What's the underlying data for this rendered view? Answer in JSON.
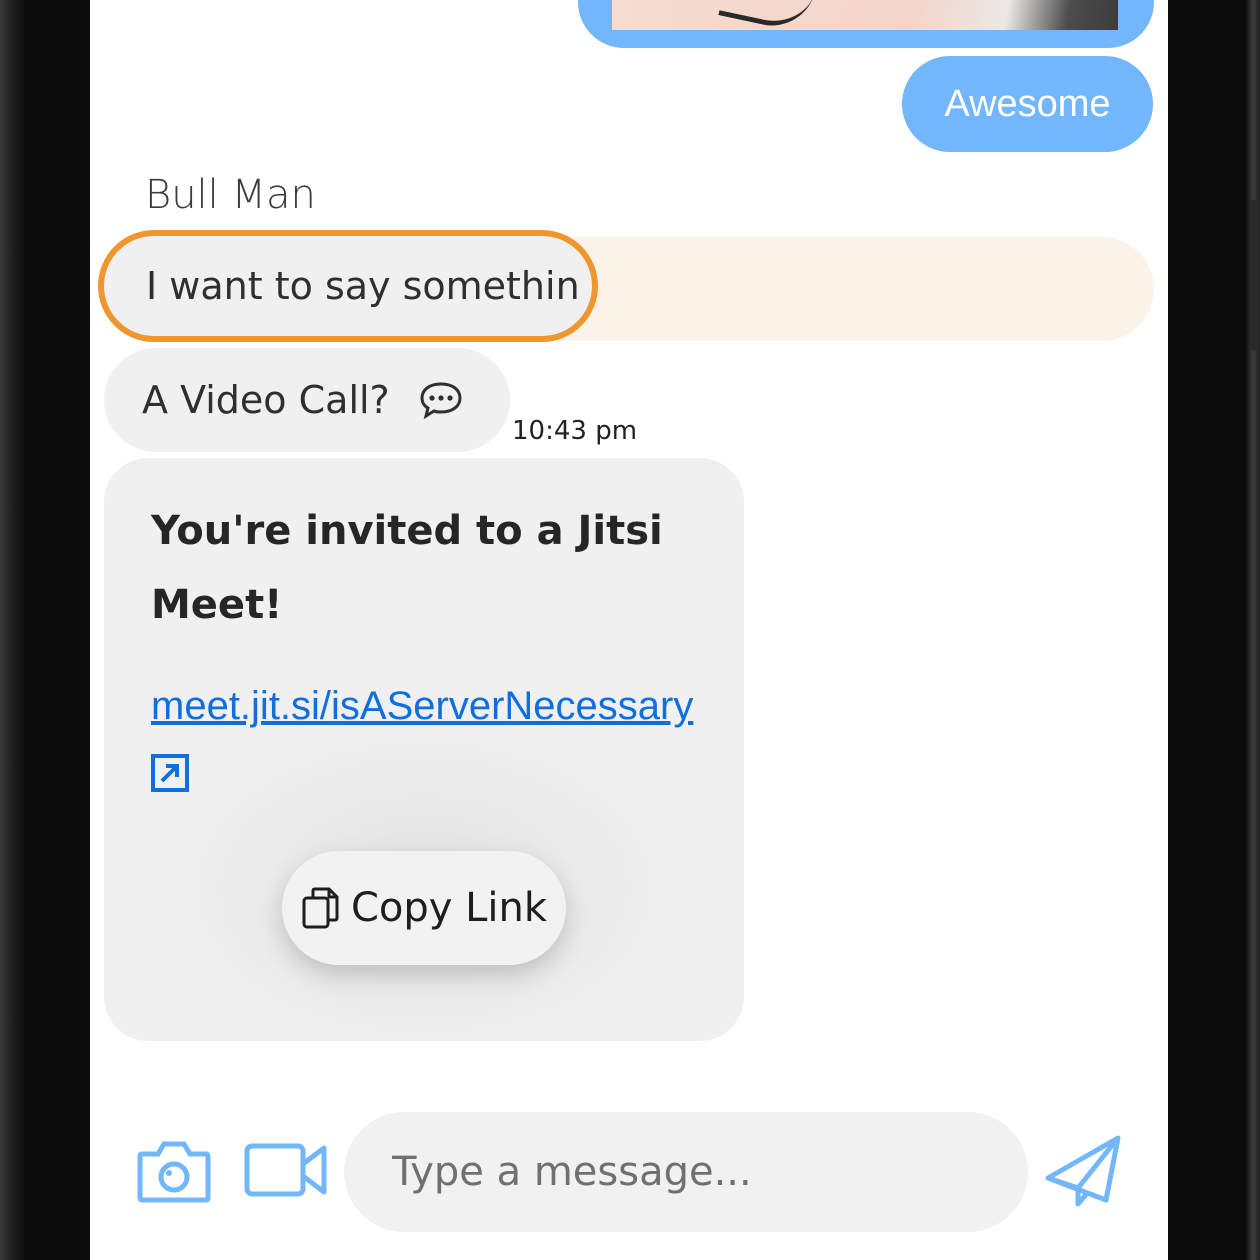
{
  "colors": {
    "outgoing_bubble": "#72b6fc",
    "incoming_bubble": "#f0f0f0",
    "highlight_row": "#fbf2e8",
    "highlight_border": "#f0962e",
    "link": "#0d6fe0",
    "icon_accent": "#72b6fc"
  },
  "messages": {
    "outgoing_image": {
      "icon": "image-attachment"
    },
    "outgoing_text": "Awesome",
    "sender_name": "Bull Man",
    "incoming_1": "I want to say somethin",
    "incoming_2": "A Video Call?",
    "incoming_2_icon": "chat-bubble-icon",
    "timestamp": "10:43 pm"
  },
  "jitsi_card": {
    "title": "You're invited to a Jitsi Meet!",
    "link": "meet.jit.si/isAServerNecessary",
    "external_icon": "external-link-icon",
    "copy_label": "Copy Link",
    "copy_icon": "copy-icon"
  },
  "composer": {
    "camera_icon": "camera-icon",
    "video_icon": "video-camera-icon",
    "placeholder": "Type a message...",
    "send_icon": "send-icon"
  }
}
